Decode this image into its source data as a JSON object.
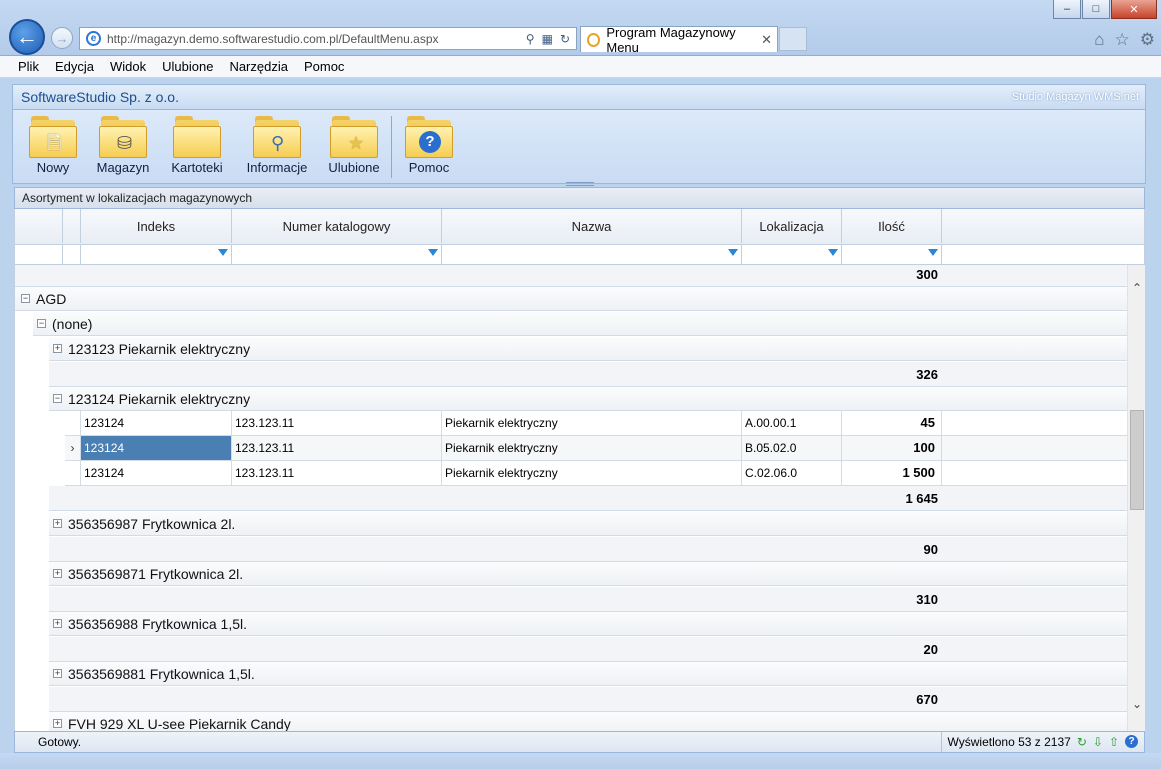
{
  "browser": {
    "url": "http://magazyn.demo.softwarestudio.com.pl/DefaultMenu.aspx",
    "tab_title": "Program Magazynowy Menu",
    "window_buttons": [
      "–",
      "□",
      "✕"
    ]
  },
  "menu": [
    "Plik",
    "Edycja",
    "Widok",
    "Ulubione",
    "Narzędzia",
    "Pomoc"
  ],
  "app": {
    "company": "SoftwareStudio Sp. z o.o.",
    "product": "Studio Magazyn WMS.net"
  },
  "toolbar": [
    {
      "label": "Nowy",
      "icon": "new-document-folder-icon"
    },
    {
      "label": "Magazyn",
      "icon": "database-folder-icon"
    },
    {
      "label": "Kartoteki",
      "icon": "folder-icon"
    },
    {
      "label": "Informacje",
      "icon": "search-folder-icon"
    },
    {
      "label": "Ulubione",
      "icon": "favorites-folder-icon"
    },
    {
      "label": "Pomoc",
      "icon": "help-folder-icon"
    }
  ],
  "panel": {
    "title": "Asortyment w lokalizacjach magazynowych",
    "columns": [
      "Indeks",
      "Numer katalogowy",
      "Nazwa",
      "Lokalizacja",
      "Ilość"
    ]
  },
  "grid": {
    "top_total": "300",
    "group1": "AGD",
    "group2": "(none)",
    "items": [
      {
        "title": "123123 Piekarnik elektryczny",
        "expanded": false,
        "total": "326"
      },
      {
        "title": "123124 Piekarnik elektryczny",
        "expanded": true,
        "total": "1 645",
        "rows": [
          {
            "indeks": "123124",
            "numer": "123.123.11",
            "nazwa": "Piekarnik elektryczny",
            "lok": "A.00.00.1",
            "ilosc": "45"
          },
          {
            "indeks": "123124",
            "numer": "123.123.11",
            "nazwa": "Piekarnik elektryczny",
            "lok": "B.05.02.0",
            "ilosc": "100"
          },
          {
            "indeks": "123124",
            "numer": "123.123.11",
            "nazwa": "Piekarnik elektryczny",
            "lok": "C.02.06.0",
            "ilosc": "1 500"
          }
        ]
      },
      {
        "title": "356356987 Frytkownica 2l.",
        "expanded": false,
        "total": "90"
      },
      {
        "title": "3563569871 Frytkownica 2l.",
        "expanded": false,
        "total": "310"
      },
      {
        "title": "356356988 Frytkownica 1,5l.",
        "expanded": false,
        "total": "20"
      },
      {
        "title": "3563569881 Frytkownica 1,5l.",
        "expanded": false,
        "total": "670"
      },
      {
        "title": "FVH 929 XL U-see Piekarnik Candy",
        "expanded": false
      }
    ]
  },
  "status": {
    "left": "Gotowy.",
    "right": "Wyświetlono 53 z 2137"
  },
  "colors": {
    "selection": "#4a7fb4",
    "header_blue": "#1d4e8f"
  }
}
